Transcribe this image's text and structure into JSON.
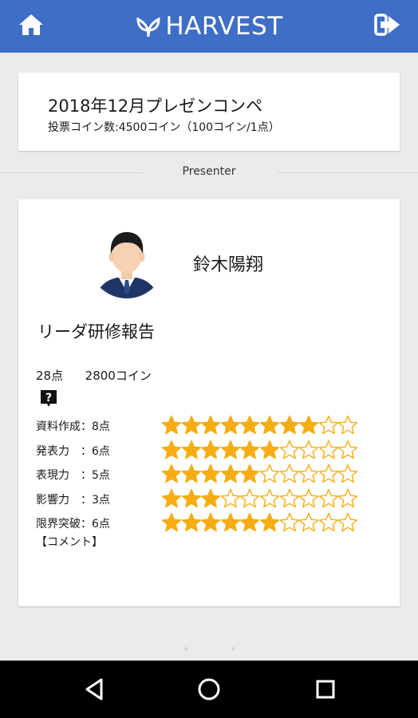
{
  "app": {
    "brand": "HARVEST",
    "colors": {
      "header": "#3f6ec7",
      "star_filled": "#f5ad13",
      "star_empty_outline": "#f5ad13",
      "nav_bar": "#000000"
    },
    "icons": {
      "home": "home-icon",
      "logout": "logout-icon",
      "brand": "sprout-icon"
    }
  },
  "event": {
    "title": "2018年12月プレゼンコンペ",
    "subtitle": "投票コイン数:4500コイン（100コイン/1点）"
  },
  "section": {
    "label": "Presenter"
  },
  "presenter": {
    "name": "鈴木陽翔",
    "talk_title": "リーダ研修報告",
    "points": "28点",
    "coins": "2800コイン",
    "help_icon": "question-icon",
    "ratings": [
      {
        "label": "資料作成：8点",
        "score": 8,
        "max": 10
      },
      {
        "label": "発表力　：6点",
        "score": 6,
        "max": 10
      },
      {
        "label": "表現力　：5点",
        "score": 5,
        "max": 10
      },
      {
        "label": "影響力　：3点",
        "score": 3,
        "max": 10
      },
      {
        "label": "限界突破：6点",
        "score": 6,
        "max": 10
      }
    ],
    "comment_label": "【コメント】"
  },
  "nav": {
    "icons": [
      "back-icon",
      "home-circle-icon",
      "recents-icon"
    ]
  }
}
